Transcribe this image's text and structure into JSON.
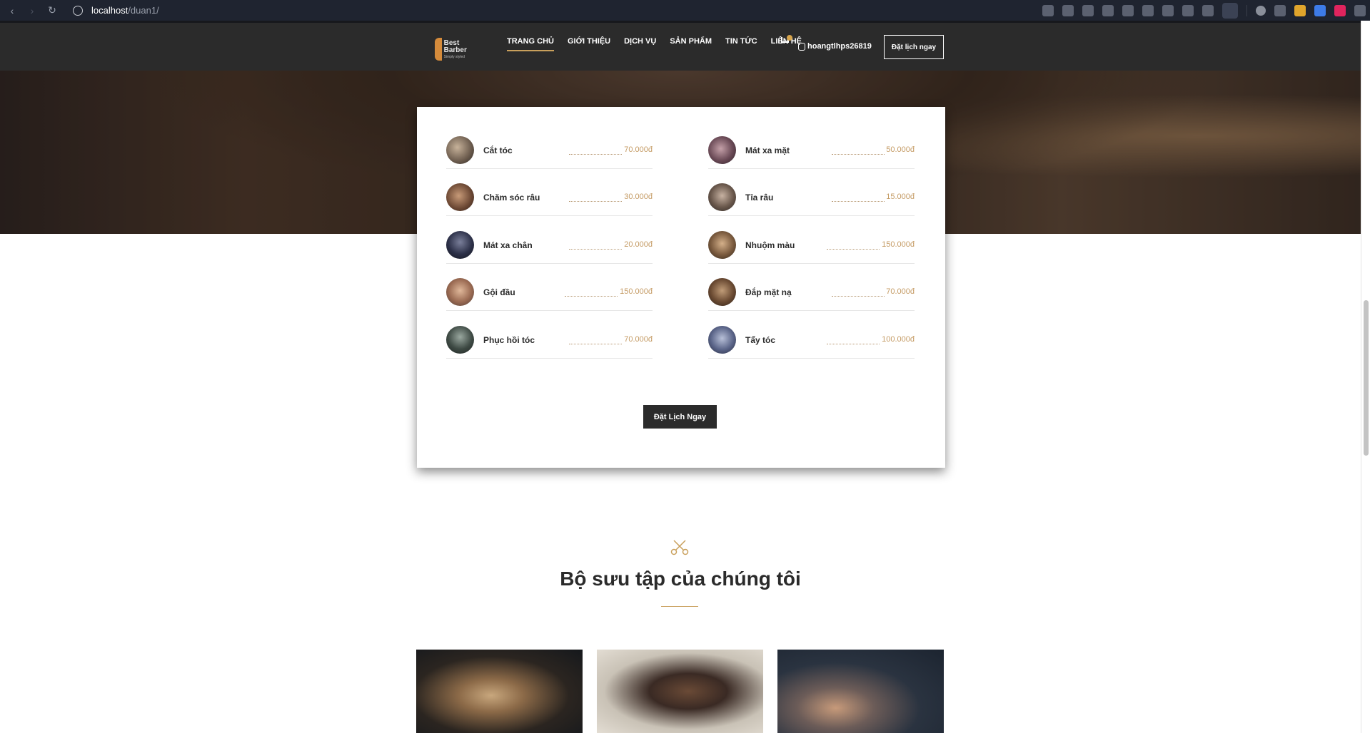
{
  "browser": {
    "url_host": "localhost",
    "url_path": "/duan1/",
    "icons": [
      "back-icon",
      "forward-icon",
      "reload-icon",
      "site-info-icon"
    ]
  },
  "header": {
    "logo_title": "Best Barber",
    "logo_subtitle": "Simply styled",
    "nav": [
      {
        "label": "TRANG CHỦ",
        "active": true
      },
      {
        "label": "GIỚI THIỆU",
        "active": false
      },
      {
        "label": "DỊCH VỤ",
        "active": false
      },
      {
        "label": "SẢN PHẨM",
        "active": false
      },
      {
        "label": "TIN TỨC",
        "active": false
      },
      {
        "label": "LIÊN HỆ",
        "active": false
      }
    ],
    "username": "hoangtlhps26819",
    "book_button": "Đặt lịch ngay"
  },
  "services": {
    "left": [
      {
        "name": "Cắt tóc",
        "price": "70.000đ"
      },
      {
        "name": "Chăm sóc râu",
        "price": "30.000đ"
      },
      {
        "name": "Mát xa chân",
        "price": "20.000đ"
      },
      {
        "name": "Gội đầu",
        "price": "150.000đ"
      },
      {
        "name": "Phục hồi tóc",
        "price": "70.000đ"
      }
    ],
    "right": [
      {
        "name": "Mát xa mặt",
        "price": "50.000đ"
      },
      {
        "name": "Tỉa râu",
        "price": "15.000đ"
      },
      {
        "name": "Nhuộm màu",
        "price": "150.000đ"
      },
      {
        "name": "Đắp mặt nạ",
        "price": "70.000đ"
      },
      {
        "name": "Tẩy tóc",
        "price": "100.000đ"
      }
    ],
    "cta_button": "Đặt Lịch Ngay"
  },
  "collection": {
    "title": "Bộ sưu tập của chúng tôi",
    "icon": "scissors-icon"
  },
  "colors": {
    "accent": "#c9a05c",
    "price": "#c49a63",
    "header_bg": "#2b2b2b"
  }
}
